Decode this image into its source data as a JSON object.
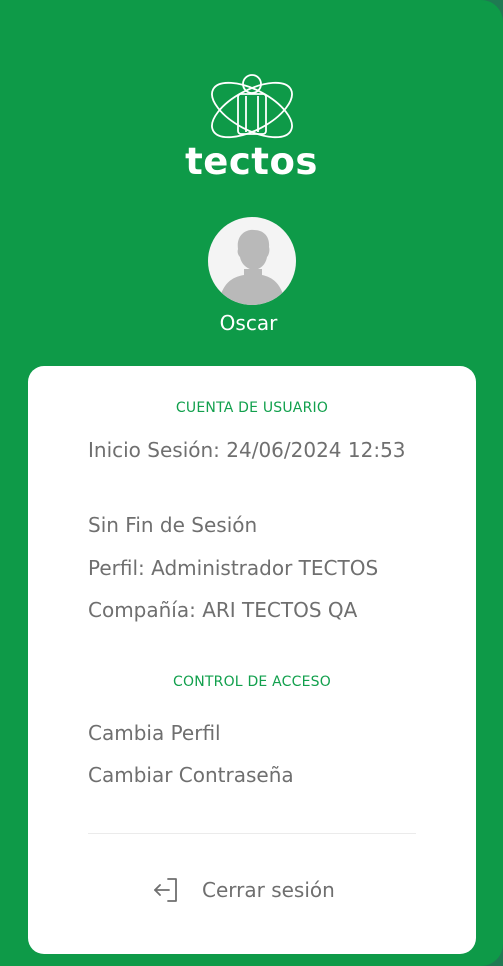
{
  "brand": {
    "name": "tectos"
  },
  "user": {
    "name": "Oscar"
  },
  "account": {
    "section_title": "CUENTA DE USUARIO",
    "login": "Inicio Sesión: 24/06/2024 12:53",
    "session_end": "Sin Fin de Sesión",
    "profile": "Perfil: Administrador TECTOS",
    "company": "Compañía: ARI TECTOS QA"
  },
  "access": {
    "section_title": "CONTROL DE ACCESO",
    "change_profile": "Cambia Perfil",
    "change_password": "Cambiar Contraseña"
  },
  "logout": {
    "label": "Cerrar sesión",
    "icon": "logout-icon"
  },
  "colors": {
    "panel": "#0e9a48",
    "accent": "#12a04d",
    "text_muted": "#6f6f6f",
    "card": "#ffffff"
  }
}
